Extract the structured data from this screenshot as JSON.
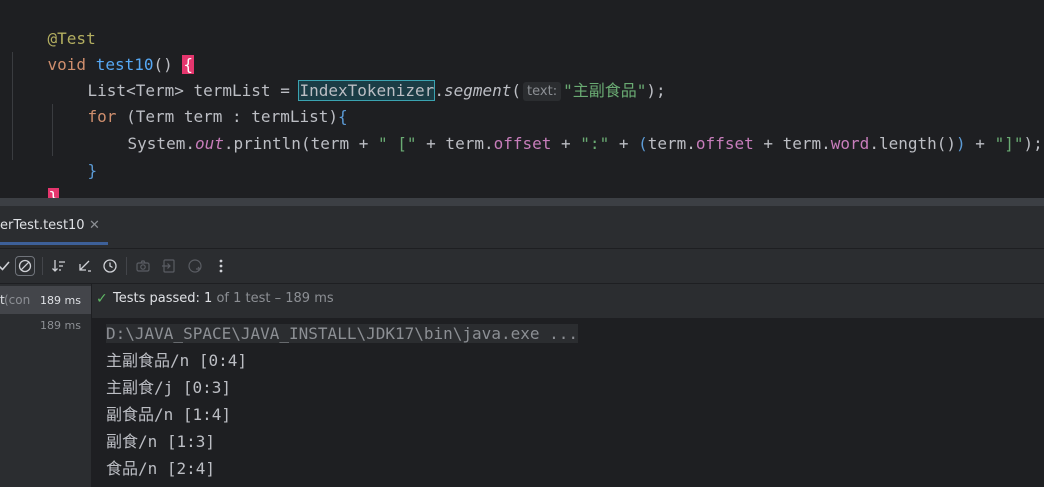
{
  "editor": {
    "annotation": "@Test",
    "method_keyword": "void",
    "method_name": "test10",
    "method_parens": "() ",
    "open_brace": "{",
    "line3_prefix": "List<Term> termList = ",
    "line3_class": "IndexTokenizer",
    "line3_dot": ".",
    "line3_method": "segment",
    "line3_paren": "(",
    "line3_hint": "text:",
    "line3_string": "\"主副食品\"",
    "line3_end": ");",
    "line4_keyword": "for",
    "line4_rest": " (Term term : termList)",
    "line4_brace": "{",
    "line5_system": "System.",
    "line5_out": "out",
    "line5_println": ".println(term + ",
    "line5_str1": "\" [\"",
    "line5_mid1": " + term.",
    "line5_offset1": "offset",
    "line5_plus1": " + ",
    "line5_str2": "\":\"",
    "line5_plus2": " + ",
    "line5_paren_open": "(",
    "line5_term2": "term.",
    "line5_offset2": "offset",
    "line5_plus3": " + term.",
    "line5_word": "word",
    "line5_length": ".length()",
    "line5_paren_close": ")",
    "line5_plus4": " + ",
    "line5_str3": "\"]\"",
    "line5_end": ");",
    "line6_brace": "}",
    "close_brace": "}"
  },
  "run_panel": {
    "tab_label": "erTest.test10",
    "tab_close": "✕",
    "toolbar_icons": [
      "check-icon",
      "stop-icon",
      "sort-icon",
      "collapse-icon",
      "clock-icon",
      "camera-icon",
      "import-icon",
      "export-icon",
      "more-icon"
    ],
    "tree": {
      "row1_label": "t",
      "row1_muted": " (con",
      "row1_time": "189 ms",
      "row2_time": "189 ms"
    },
    "status": {
      "check": "✓",
      "prefix": "Tests passed: ",
      "count": "1",
      "suffix": " of 1 test – 189 ms"
    },
    "console_lines": [
      "D:\\JAVA_SPACE\\JAVA_INSTALL\\JDK17\\bin\\java.exe ...",
      "主副食品/n [0:4]",
      "主副食/j [0:3]",
      "副食品/n [1:4]",
      "副食/n [1:3]",
      "食品/n [2:4]"
    ]
  },
  "colors": {
    "background": "#1e1f22",
    "keyword": "#cf8e6d",
    "method": "#56a8f5",
    "string": "#6aab73",
    "field": "#c77dbb",
    "pass_green": "#5fb865",
    "brace_highlight": "#e5366e"
  }
}
